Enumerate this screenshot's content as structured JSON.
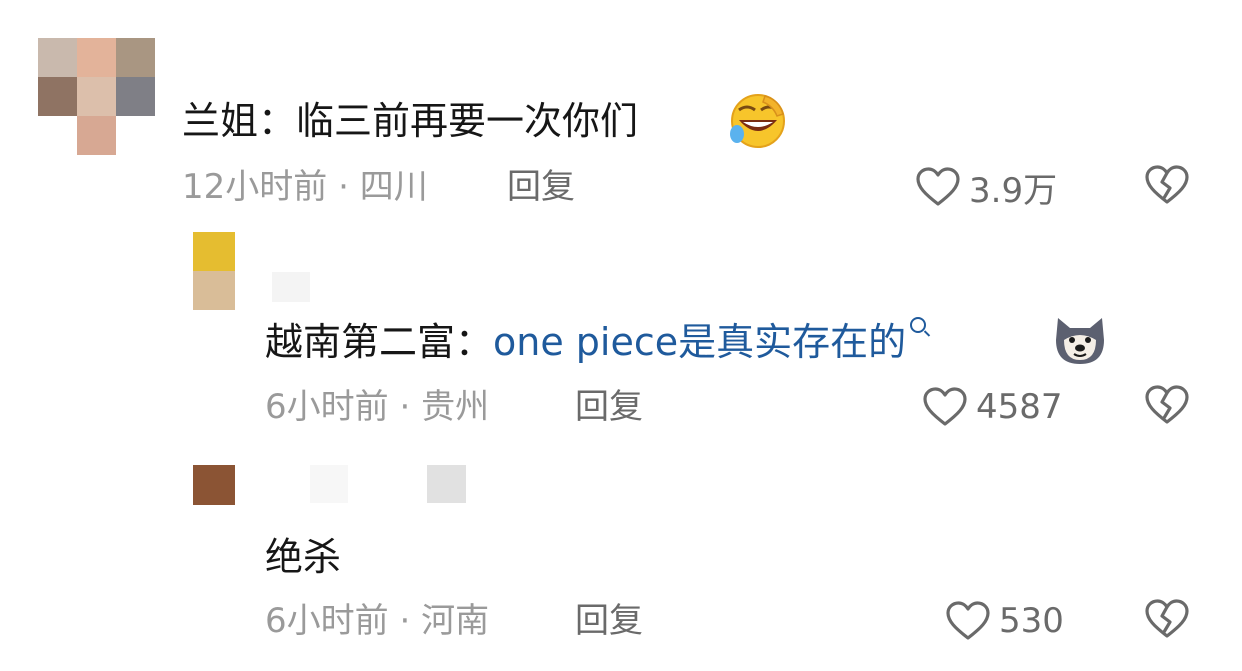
{
  "comments": [
    {
      "text_author": "兰姐：",
      "text_body": "临三前再要一次你们",
      "emoji": "rolling-laughing-emoji",
      "time": "12小时前",
      "location": "四川",
      "separator": "·",
      "reply_label": "回复",
      "likes": "3.9万"
    },
    {
      "text_author": "越南第二富：",
      "text_mention": "one piece是真实存在的",
      "emoji": "doge-dog-emoji",
      "time": "6小时前",
      "location": "贵州",
      "separator": "·",
      "reply_label": "回复",
      "likes": "4587"
    },
    {
      "text_body": "绝杀",
      "time": "6小时前",
      "location": "河南",
      "separator": "·",
      "reply_label": "回复",
      "likes": "530"
    }
  ],
  "icons": {
    "like": "heart-outline-icon",
    "dislike": "broken-heart-icon",
    "mention_search": "search-icon"
  },
  "colors": {
    "text": "#161616",
    "meta": "#9a9a9a",
    "action": "#6a6a6a",
    "mention": "#1f5a9c"
  }
}
